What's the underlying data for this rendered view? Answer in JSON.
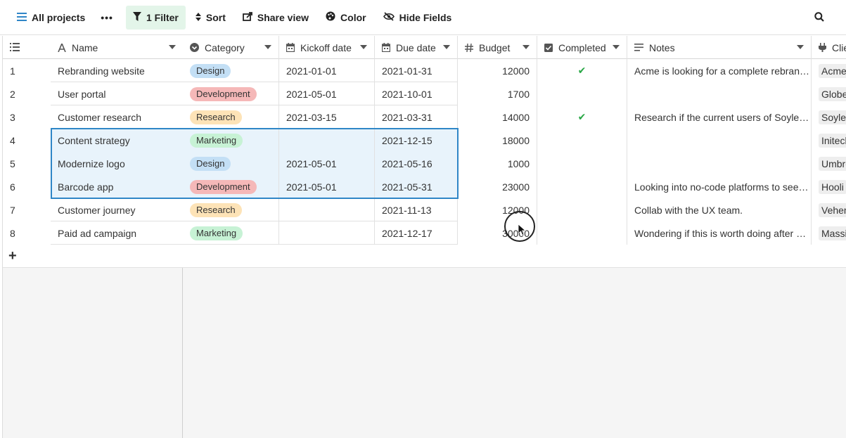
{
  "toolbar": {
    "views_label": "All projects",
    "more_label": "•••",
    "filter_label": "1 Filter",
    "sort_label": "Sort",
    "share_label": "Share view",
    "color_label": "Color",
    "hide_label": "Hide Fields"
  },
  "columns": {
    "name": "Name",
    "category": "Category",
    "kickoff": "Kickoff date",
    "due": "Due date",
    "budget": "Budget",
    "completed": "Completed",
    "notes": "Notes",
    "client": "Clie"
  },
  "category_colors": {
    "Design": "#c3dff5",
    "Development": "#f5b8b8",
    "Research": "#fde3b7",
    "Marketing": "#c7f2d5"
  },
  "accent_color": "#2f86c7",
  "rows": [
    {
      "num": "1",
      "name": "Rebranding website",
      "category": "Design",
      "kickoff": "2021-01-01",
      "due": "2021-01-31",
      "budget": "12000",
      "completed": "✔",
      "notes": "Acme is looking for a complete rebran…",
      "client": "Acme"
    },
    {
      "num": "2",
      "name": "User portal",
      "category": "Development",
      "kickoff": "2021-05-01",
      "due": "2021-10-01",
      "budget": "1700",
      "completed": "",
      "notes": "",
      "client": "Globe"
    },
    {
      "num": "3",
      "name": "Customer research",
      "category": "Research",
      "kickoff": "2021-03-15",
      "due": "2021-03-31",
      "budget": "14000",
      "completed": "✔",
      "notes": "Research if the current users of Soyle…",
      "client": "Soyler"
    },
    {
      "num": "4",
      "name": "Content strategy",
      "category": "Marketing",
      "kickoff": "",
      "due": "2021-12-15",
      "budget": "18000",
      "completed": "",
      "notes": "",
      "client": "Initech"
    },
    {
      "num": "5",
      "name": "Modernize logo",
      "category": "Design",
      "kickoff": "2021-05-01",
      "due": "2021-05-16",
      "budget": "1000",
      "completed": "",
      "notes": "",
      "client": "Umbre"
    },
    {
      "num": "6",
      "name": "Barcode app",
      "category": "Development",
      "kickoff": "2021-05-01",
      "due": "2021-05-31",
      "budget": "23000",
      "completed": "",
      "notes": "Looking into no-code platforms to see…",
      "client": "Hooli"
    },
    {
      "num": "7",
      "name": "Customer journey",
      "category": "Research",
      "kickoff": "",
      "due": "2021-11-13",
      "budget": "12000",
      "completed": "",
      "notes": "Collab with the UX team.",
      "client": "Vehen"
    },
    {
      "num": "8",
      "name": "Paid ad campaign",
      "category": "Marketing",
      "kickoff": "",
      "due": "2021-12-17",
      "budget": "30000",
      "completed": "",
      "notes": "Wondering if this is worth doing after …",
      "client": "Massiv"
    }
  ],
  "add_row_label": "+"
}
